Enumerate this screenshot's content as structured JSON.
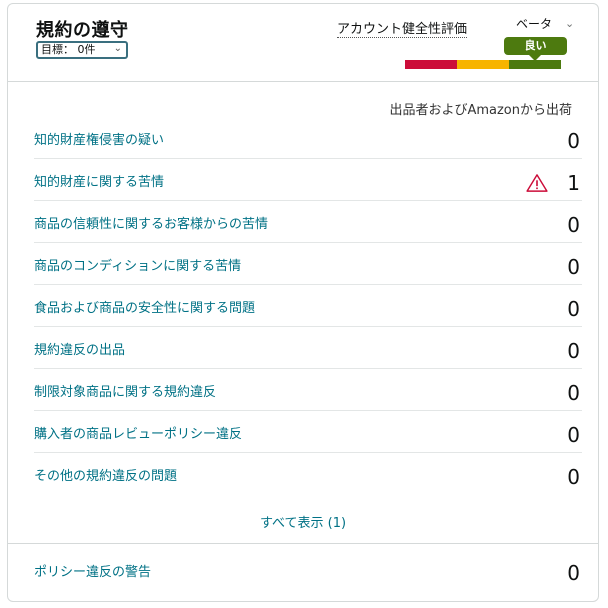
{
  "header": {
    "title": "規約の遵守",
    "goal_select": "目標： 0件",
    "rating_label": "アカウント健全性評価",
    "rating_beta": "ベータ",
    "rating_badge": "良い",
    "rating_colors": {
      "bad": "#cc0c39",
      "fair": "#f7b400",
      "good": "#4d7a0f"
    }
  },
  "table": {
    "column_header": "出品者およびAmazonから出荷",
    "rows": [
      {
        "label": "知的財産権侵害の疑い",
        "value": "0"
      },
      {
        "label": "知的財産に関する苦情",
        "value": "1",
        "icon": "warning-icon"
      },
      {
        "label": "商品の信頼性に関するお客様からの苦情",
        "value": "0"
      },
      {
        "label": "商品のコンディションに関する苦情",
        "value": "0"
      },
      {
        "label": "食品および商品の安全性に関する問題",
        "value": "0"
      },
      {
        "label": "規約違反の出品",
        "value": "0"
      },
      {
        "label": "制限対象商品に関する規約違反",
        "value": "0"
      },
      {
        "label": "購入者の商品レビューポリシー違反",
        "value": "0"
      },
      {
        "label": "その他の規約違反の問題",
        "value": "0"
      }
    ],
    "show_all": "すべて表示 (1)"
  },
  "policy_warning": {
    "label": "ポリシー違反の警告",
    "value": "0"
  }
}
